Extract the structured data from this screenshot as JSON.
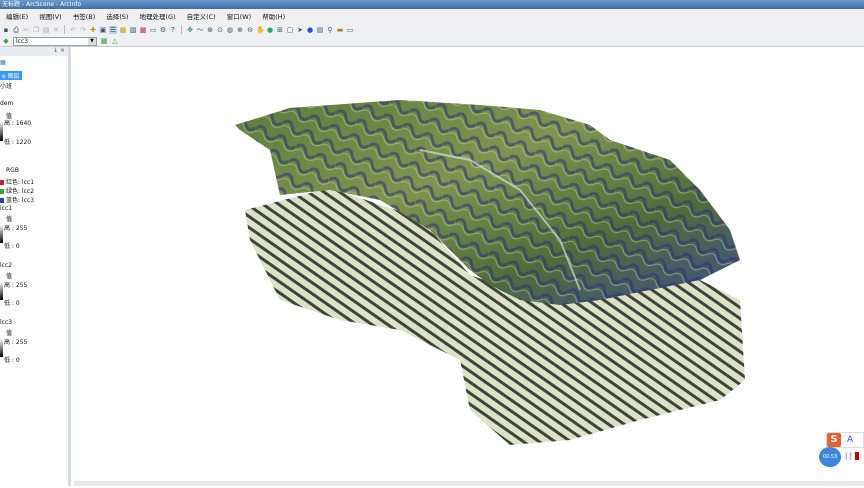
{
  "window": {
    "title": "无标题 - ArcScene - ArcInfo"
  },
  "menu": [
    "编辑(E)",
    "视图(V)",
    "书签(B)",
    "选择(S)",
    "地理处理(G)",
    "自定义(C)",
    "窗口(W)",
    "帮助(H)"
  ],
  "toolbar2": {
    "layer_value": "lcc3"
  },
  "toc": {
    "header_controls": "↓ ×",
    "scene_layers_label": "e 图层",
    "item1": "小班",
    "dem": {
      "name": "dem",
      "value_label": "值",
      "high": "高 : 1640",
      "low": "低 : 1220"
    },
    "rgb": {
      "label": "RGB",
      "red": "红色:  lcc1",
      "green": "绿色: lcc2",
      "blue": "蓝色:  lcc3"
    },
    "lcc1": {
      "name": "lcc1",
      "value_label": "值",
      "high": "高 : 255",
      "low": "低 : 0"
    },
    "lcc2": {
      "name": "lcc2",
      "value_label": "值",
      "high": "高 : 255",
      "low": "低 : 0"
    },
    "lcc3": {
      "name": "lcc3",
      "value_label": "值",
      "high": "高 : 255",
      "low": "低 : 0"
    }
  },
  "ime": {
    "logo": "S",
    "mode": "A",
    "ball_text": "00:53"
  },
  "colors": {
    "selection": "#3399ff",
    "red_band": "#c0282d",
    "green_band": "#3aaa35",
    "blue_band": "#2a3ea8"
  }
}
